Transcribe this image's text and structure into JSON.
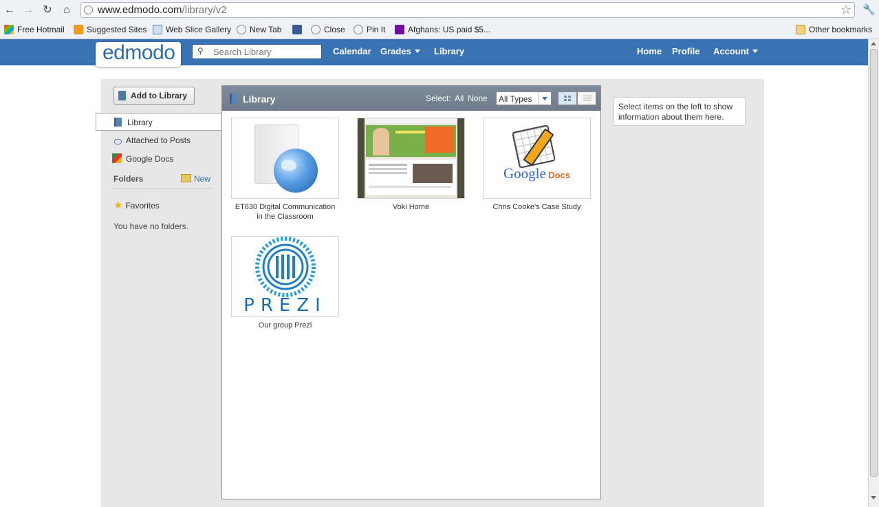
{
  "browser": {
    "url_host": "www.edmodo.com",
    "url_path": "/library/v2",
    "bookmarks": [
      {
        "label": "Free Hotmail",
        "icon": "windows-flag-icon"
      },
      {
        "label": "Suggested Sites",
        "icon": "suggested-sites-icon"
      },
      {
        "label": "Web Slice Gallery",
        "icon": "web-slice-icon"
      },
      {
        "label": "New Tab",
        "icon": "globe-icon"
      },
      {
        "label": "",
        "icon": "facebook-icon"
      },
      {
        "label": "Close",
        "icon": "globe-icon"
      },
      {
        "label": "Pin It",
        "icon": "globe-icon"
      },
      {
        "label": "Afghans: US paid $5...",
        "icon": "yahoo-icon"
      }
    ],
    "other_bookmarks": "Other bookmarks"
  },
  "header": {
    "logo": "edmodo",
    "search_placeholder": "Search Library",
    "nav_left": [
      "Calendar",
      "Grades",
      "Library"
    ],
    "nav_right": [
      "Home",
      "Profile",
      "Account"
    ],
    "brand_color": "#3a73b4"
  },
  "sidebar": {
    "add_button": "Add to Library",
    "library": "Library",
    "attached": "Attached to Posts",
    "google_docs": "Google Docs",
    "folders_heading": "Folders",
    "new_label": "New",
    "favorites": "Favorites",
    "no_folders": "You have no folders."
  },
  "panel": {
    "title": "Library",
    "select_label": "Select:",
    "select_all": "All",
    "select_none": "None",
    "type_filter": "All Types",
    "items": [
      {
        "caption": "ET630 Digital Communication in the Classroom",
        "thumb": "globe-document"
      },
      {
        "caption": "Voki Home",
        "thumb": "voki-webpage"
      },
      {
        "caption": "Chris Cooke's Case Study",
        "thumb": "google-docs-logo"
      },
      {
        "caption": "Our group Prezi",
        "thumb": "prezi-logo"
      }
    ],
    "google_docs_logo": {
      "word1": "Google",
      "word2": "Docs"
    },
    "prezi_logo": "PREZI"
  },
  "info": {
    "text": "Select items on the left to show information about them here."
  }
}
